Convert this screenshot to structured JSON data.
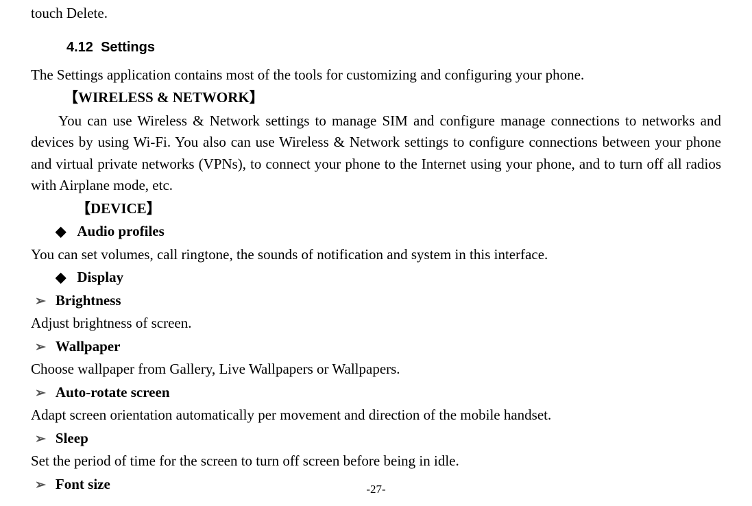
{
  "fragment": "touch Delete.",
  "heading": {
    "number": "4.12",
    "title": "Settings"
  },
  "intro": "The Settings application contains most of the tools for customizing and configuring your phone.",
  "wireless": {
    "heading": "【WIRELESS & NETWORK】",
    "para": "You can use Wireless & Network settings to manage SIM and configure manage connections to networks and devices by using Wi-Fi. You also can use Wireless & Network settings to configure connections between your phone and virtual private networks (VPNs), to connect your phone to the Internet using your phone, and to turn off all radios with Airplane mode, etc."
  },
  "device": {
    "heading": "【DEVICE】",
    "audio": {
      "title": "Audio profiles",
      "para": "You can set volumes, call ringtone, the sounds of notification and system in this interface."
    },
    "display": {
      "title": "Display",
      "items": [
        {
          "title": "Brightness",
          "desc": "Adjust brightness of screen."
        },
        {
          "title": "Wallpaper",
          "desc": "Choose wallpaper from Gallery, Live Wallpapers or Wallpapers."
        },
        {
          "title": "Auto-rotate screen",
          "desc": "Adapt screen orientation automatically per movement and direction of the mobile handset."
        },
        {
          "title": "Sleep",
          "desc": "Set the period of time for the screen to turn off screen before being in idle."
        },
        {
          "title": "Font size",
          "desc": ""
        }
      ]
    }
  },
  "bullets": {
    "diamond": "◆",
    "arrow": "➢"
  },
  "pageNumber": "-27-"
}
